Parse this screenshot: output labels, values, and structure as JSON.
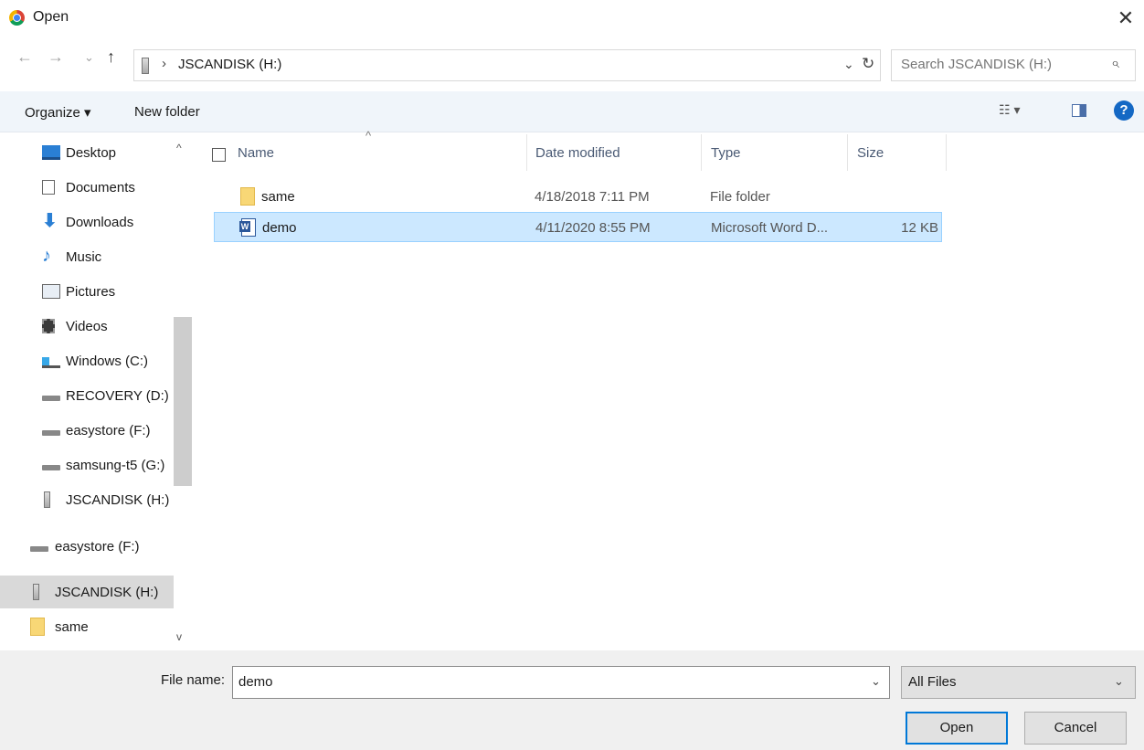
{
  "window": {
    "title": "Open",
    "close_label": "✕"
  },
  "address": {
    "back": "←",
    "forward": "→",
    "recent": "⌄",
    "up": "↑",
    "separator": "›",
    "path": "JSCANDISK (H:)",
    "dropdown": "⌄",
    "refresh": "↻"
  },
  "search": {
    "placeholder": "Search JSCANDISK (H:)",
    "icon": "⌕"
  },
  "toolbar": {
    "organize": "Organize ▾",
    "new_folder": "New folder",
    "view": "☷ ▾",
    "help": "?"
  },
  "nav": {
    "scroll_up": "^",
    "scroll_down": "v",
    "items": [
      {
        "label": "Desktop",
        "icon": "desktop-icon"
      },
      {
        "label": "Documents",
        "icon": "documents-icon"
      },
      {
        "label": "Downloads",
        "icon": "downloads-icon"
      },
      {
        "label": "Music",
        "icon": "music-icon"
      },
      {
        "label": "Pictures",
        "icon": "pictures-icon"
      },
      {
        "label": "Videos",
        "icon": "videos-icon"
      },
      {
        "label": "Windows (C:)",
        "icon": "windows-drive-icon"
      },
      {
        "label": "RECOVERY (D:)",
        "icon": "drive-icon"
      },
      {
        "label": "easystore (F:)",
        "icon": "drive-icon"
      },
      {
        "label": "samsung-t5 (G:)",
        "icon": "drive-icon"
      },
      {
        "label": "JSCANDISK (H:)",
        "icon": "usb-drive-icon"
      },
      {
        "label": "easystore (F:)",
        "icon": "drive-icon"
      },
      {
        "label": "JSCANDISK (H:)",
        "icon": "usb-drive-icon",
        "selected": true
      },
      {
        "label": "same",
        "icon": "folder-icon"
      }
    ]
  },
  "file_list": {
    "columns": [
      "Name",
      "Date modified",
      "Type",
      "Size"
    ],
    "sort_caret": "^",
    "rows": [
      {
        "name": "same",
        "date": "4/18/2018 7:11 PM",
        "type": "File folder",
        "size": "",
        "icon": "folder-icon"
      },
      {
        "name": "demo",
        "date": "4/11/2020 8:55 PM",
        "type": "Microsoft Word D...",
        "size": "12 KB",
        "icon": "word-document-icon",
        "selected": true
      }
    ]
  },
  "bottom": {
    "filename_label": "File name:",
    "filename_value": "demo",
    "filename_dropdown": "⌄",
    "filetype_value": "All Files",
    "filetype_chevron": "⌄",
    "open_label": "Open",
    "cancel_label": "Cancel"
  },
  "colors": {
    "toolbar_bg": "#f0f5fa",
    "selection_bg": "#cce8ff",
    "selection_border": "#99d1ff",
    "help_blue": "#1468c4",
    "default_button_border": "#0078d7"
  }
}
